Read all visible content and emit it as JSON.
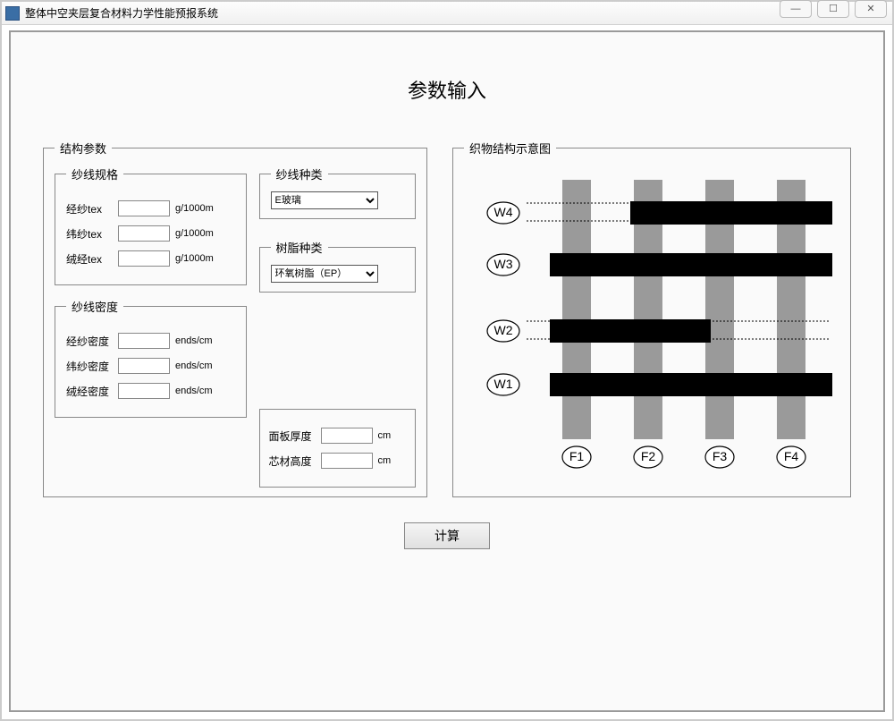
{
  "window": {
    "title": "整体中空夹层复合材料力学性能预报系统",
    "min": "—",
    "max": "☐",
    "close": "✕"
  },
  "page": {
    "title": "参数输入"
  },
  "frames": {
    "structure": "结构参数",
    "diagram": "织物结构示意图",
    "yarn_spec": "纱线规格",
    "yarn_density": "纱线密度",
    "yarn_type": "纱线种类",
    "resin_type": "树脂种类"
  },
  "yarn_spec": {
    "warp_label": "经纱tex",
    "weft_label": "纬纱tex",
    "pile_label": "绒经tex",
    "unit": "g/1000m",
    "warp_value": "",
    "weft_value": "",
    "pile_value": ""
  },
  "yarn_density": {
    "warp_label": "经纱密度",
    "weft_label": "纬纱密度",
    "pile_label": "绒经密度",
    "unit": "ends/cm",
    "warp_value": "",
    "weft_value": "",
    "pile_value": ""
  },
  "yarn_type": {
    "selected": "E玻璃"
  },
  "resin_type": {
    "selected": "环氧树脂（EP）"
  },
  "dimensions": {
    "panel_label": "面板厚度",
    "core_label": "芯材高度",
    "unit": "cm",
    "panel_value": "",
    "core_value": ""
  },
  "calc_label": "计算",
  "diagram_labels": {
    "w1": "W1",
    "w2": "W2",
    "w3": "W3",
    "w4": "W4",
    "f1": "F1",
    "f2": "F2",
    "f3": "F3",
    "f4": "F4"
  }
}
